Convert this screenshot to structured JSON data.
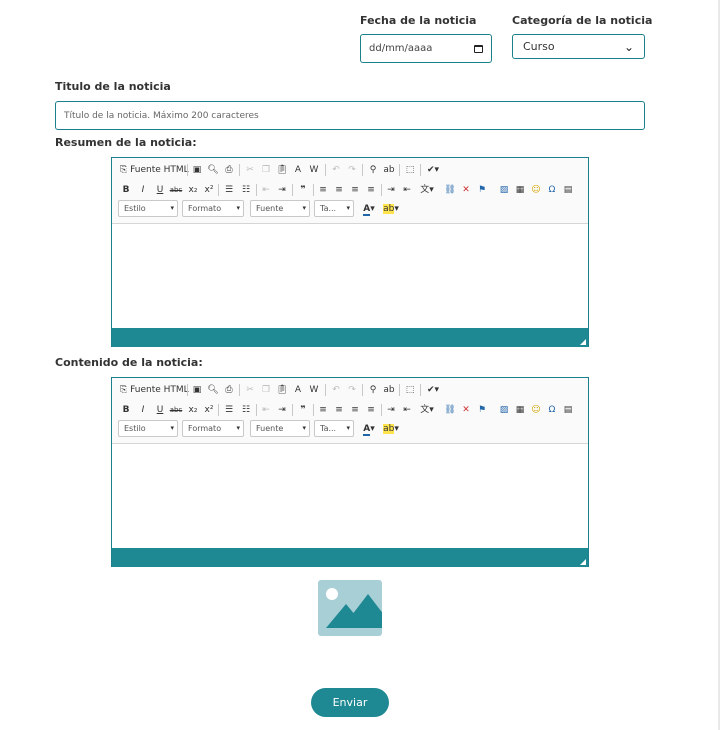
{
  "date_field": {
    "label": "Fecha de la noticia",
    "placeholder": "dd/mm/aaaa"
  },
  "category_field": {
    "label": "Categoría de la noticia",
    "selected": "Curso"
  },
  "title_field": {
    "label": "Titulo de la noticia",
    "placeholder": "Título de la noticia. Máximo 200 caracteres"
  },
  "summary_editor": {
    "label": "Resumen de la noticia:"
  },
  "content_editor": {
    "label": "Contenido de la noticia:"
  },
  "toolbar": {
    "source_label": "Fuente HTML",
    "bold": "B",
    "italic": "I",
    "underline": "U",
    "strike": "abc",
    "subscript": "x₂",
    "superscript": "x²",
    "quote": "❞",
    "omega": "Ω",
    "styles_combo": "Estilo",
    "format_combo": "Formato",
    "font_combo": "Fuente",
    "size_combo": "Ta..."
  },
  "submit_button": {
    "label": "Enviar"
  },
  "colors": {
    "accent": "#1e8893",
    "border": "#1b7f8c",
    "placeholder_image": "#a9cfd6"
  }
}
